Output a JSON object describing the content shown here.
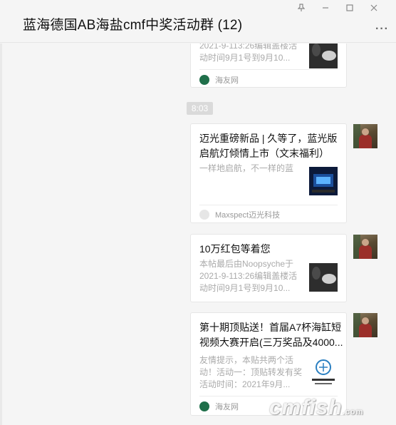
{
  "window": {
    "title": "蓝海德国AB海盐cmf中奖活动群 (12)",
    "controls": [
      "pin-icon",
      "minimize-icon",
      "maximize-icon",
      "close-icon"
    ],
    "more_label": "···"
  },
  "timestamp": "8:03",
  "messages": [
    {
      "desc": "2021-9-113:26编辑盖楼活动时间9月1号到9月10...",
      "source": "海友网",
      "source_icon_color": "#1f6f4a"
    },
    {
      "title": "迈光重磅新品 | 久等了，蓝光版启航灯倾情上市（文末福利）",
      "desc": "一样地启航，不一样的蓝",
      "source": "Maxspect迈光科技",
      "source_icon_color": "#cccccc"
    },
    {
      "title": "10万红包等着您",
      "desc": "本帖最后由Noopsyche于2021-9-113:26编辑盖楼活动时间9月1号到9月10...",
      "source": "",
      "source_icon_color": ""
    },
    {
      "title": "第十期顶贴送！首届A7杯海缸短视频大赛开启(三万奖品及4000...",
      "desc": "友情提示，本贴共两个活动！活动一：顶贴转发有奖活动时间：2021年9月...",
      "source": "海友网",
      "source_icon_color": "#1f6f4a"
    }
  ],
  "watermark": {
    "text": "cmfish",
    "suffix": ".com"
  },
  "colors": {
    "background": "#f5f5f5",
    "card": "#ffffff",
    "desc_text": "#aaaaaa",
    "time_badge": "#dadada"
  }
}
